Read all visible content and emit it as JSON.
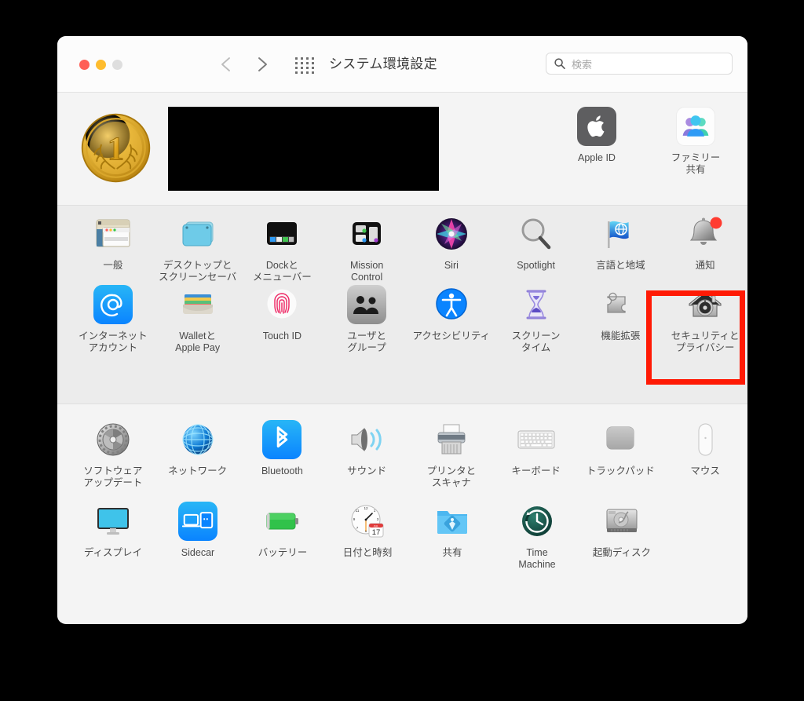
{
  "window": {
    "title": "システム環境設定",
    "traffic_lights": [
      "close",
      "minimize",
      "zoom"
    ],
    "nav_back": "back-chevron",
    "nav_forward": "forward-chevron",
    "grid_button": "show-all-grid-icon",
    "search": {
      "placeholder": "検索",
      "value": "",
      "icon": "search-icon"
    }
  },
  "account": {
    "avatar_icon": "gold-medal-1-avatar",
    "name_redacted": true,
    "items": [
      {
        "label": "Apple ID",
        "icon": "apple-id-icon"
      },
      {
        "label": "ファミリー\n共有",
        "label_line1": "ファミリー",
        "label_line2": "共有",
        "icon": "family-sharing-icon"
      }
    ]
  },
  "sections": [
    {
      "name": "personal",
      "rows": [
        [
          {
            "label_line1": "一般",
            "label_line2": "",
            "icon": "general-icon"
          },
          {
            "label_line1": "デスクトップと",
            "label_line2": "スクリーンセーバ",
            "icon": "desktop-screensaver-icon"
          },
          {
            "label_line1": "Dockと",
            "label_line2": "メニューバー",
            "icon": "dock-menubar-icon"
          },
          {
            "label_line1": "Mission",
            "label_line2": "Control",
            "icon": "mission-control-icon"
          },
          {
            "label_line1": "Siri",
            "label_line2": "",
            "icon": "siri-icon"
          },
          {
            "label_line1": "Spotlight",
            "label_line2": "",
            "icon": "spotlight-icon"
          },
          {
            "label_line1": "言語と地域",
            "label_line2": "",
            "icon": "language-region-icon"
          },
          {
            "label_line1": "通知",
            "label_line2": "",
            "icon": "notifications-icon",
            "badge": true
          }
        ],
        [
          {
            "label_line1": "インターネット",
            "label_line2": "アカウント",
            "icon": "internet-accounts-icon"
          },
          {
            "label_line1": "Walletと",
            "label_line2": "Apple Pay",
            "icon": "wallet-apple-pay-icon"
          },
          {
            "label_line1": "Touch ID",
            "label_line2": "",
            "icon": "touch-id-icon"
          },
          {
            "label_line1": "ユーザと",
            "label_line2": "グループ",
            "icon": "users-groups-icon"
          },
          {
            "label_line1": "アクセシビリティ",
            "label_line2": "",
            "icon": "accessibility-icon"
          },
          {
            "label_line1": "スクリーン",
            "label_line2": "タイム",
            "icon": "screen-time-icon"
          },
          {
            "label_line1": "機能拡張",
            "label_line2": "",
            "icon": "extensions-icon"
          },
          {
            "label_line1": "セキュリティと",
            "label_line2": "プライバシー",
            "icon": "security-privacy-icon",
            "highlighted": true
          }
        ]
      ]
    },
    {
      "name": "hardware",
      "rows": [
        [
          {
            "label_line1": "ソフトウェア",
            "label_line2": "アップデート",
            "icon": "software-update-icon"
          },
          {
            "label_line1": "ネットワーク",
            "label_line2": "",
            "icon": "network-icon"
          },
          {
            "label_line1": "Bluetooth",
            "label_line2": "",
            "icon": "bluetooth-icon"
          },
          {
            "label_line1": "サウンド",
            "label_line2": "",
            "icon": "sound-icon"
          },
          {
            "label_line1": "プリンタと",
            "label_line2": "スキャナ",
            "icon": "printers-scanners-icon"
          },
          {
            "label_line1": "キーボード",
            "label_line2": "",
            "icon": "keyboard-icon"
          },
          {
            "label_line1": "トラックパッド",
            "label_line2": "",
            "icon": "trackpad-icon"
          },
          {
            "label_line1": "マウス",
            "label_line2": "",
            "icon": "mouse-icon"
          }
        ],
        [
          {
            "label_line1": "ディスプレイ",
            "label_line2": "",
            "icon": "displays-icon"
          },
          {
            "label_line1": "Sidecar",
            "label_line2": "",
            "icon": "sidecar-icon"
          },
          {
            "label_line1": "バッテリー",
            "label_line2": "",
            "icon": "battery-icon"
          },
          {
            "label_line1": "日付と時刻",
            "label_line2": "",
            "icon": "date-time-icon",
            "calendar_month": "JUL",
            "calendar_day": "17"
          },
          {
            "label_line1": "共有",
            "label_line2": "",
            "icon": "sharing-icon"
          },
          {
            "label_line1": "Time",
            "label_line2": "Machine",
            "icon": "time-machine-icon"
          },
          {
            "label_line1": "起動ディスク",
            "label_line2": "",
            "icon": "startup-disk-icon"
          }
        ]
      ]
    }
  ],
  "annotation": {
    "type": "red-rectangle-highlight",
    "target": "セキュリティとプライバシー",
    "color": "#ff1a05"
  }
}
